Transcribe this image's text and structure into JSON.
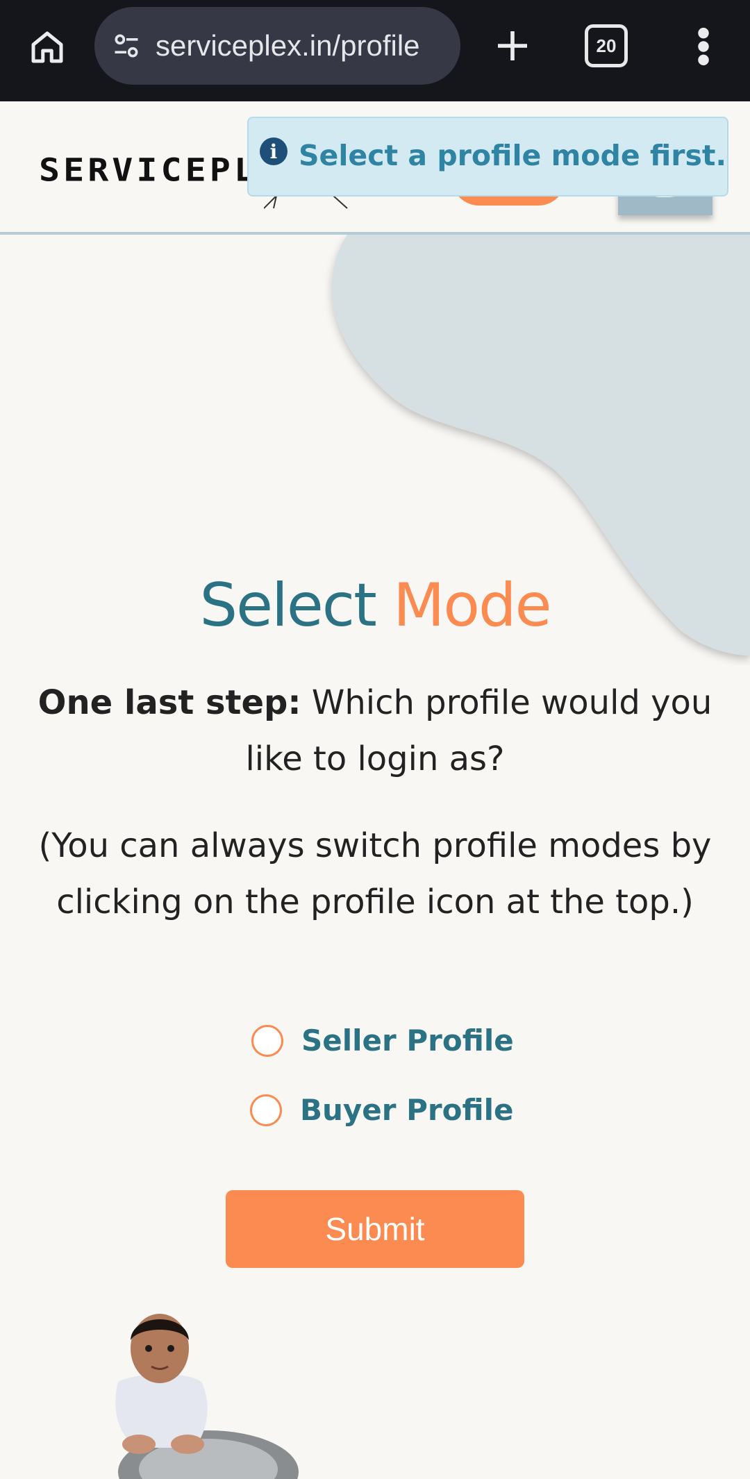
{
  "browser": {
    "url": "serviceplex.in/profile",
    "tab_count": "20",
    "icons": [
      "home-icon",
      "tune-icon",
      "plus-icon",
      "tabs-icon",
      "more-vert-icon"
    ]
  },
  "header": {
    "logo_text": "SERVICEPL"
  },
  "toast": {
    "message": "Select a profile mode first.",
    "icon": "info-icon",
    "icon_glyph": "i"
  },
  "main": {
    "title_part1": "Select",
    "title_part2": "Mode",
    "step_bold": "One last step:",
    "step_text": " Which profile would you like to login as?",
    "note": "(You can always switch profile modes by clicking on the profile icon at the top.)",
    "options": [
      {
        "label": "Seller Profile",
        "selected": false
      },
      {
        "label": "Buyer Profile",
        "selected": false
      }
    ],
    "submit_label": "Submit"
  },
  "colors": {
    "accent_orange": "#fb8b50",
    "accent_teal": "#2b7285",
    "toast_bg": "#d3eaf2",
    "blob": "#d6e0e2"
  }
}
